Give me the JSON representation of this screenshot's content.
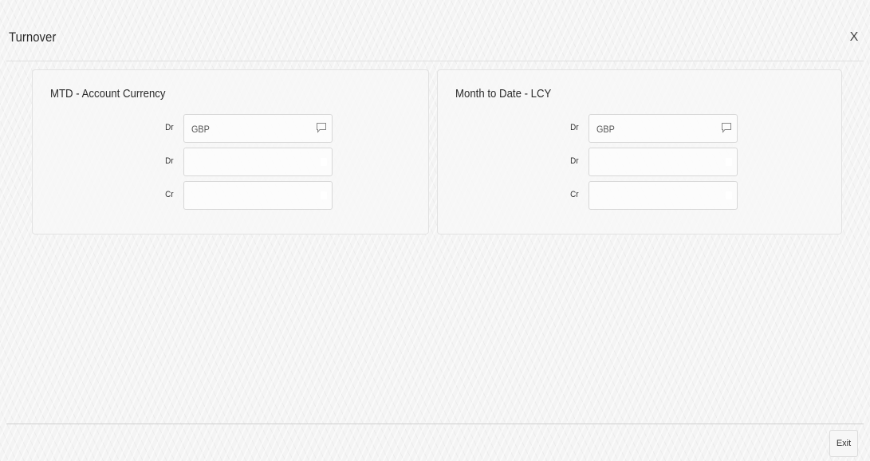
{
  "window": {
    "title": "Turnover",
    "close_label": "X"
  },
  "panels": [
    {
      "heading": "MTD - Account Currency",
      "rows": [
        {
          "label": "Dr",
          "value": "GBP",
          "icon": "note-icon"
        },
        {
          "label": "Dr",
          "value": "",
          "icon": null
        },
        {
          "label": "Cr",
          "value": "",
          "icon": null
        }
      ]
    },
    {
      "heading": "Month to Date - LCY",
      "rows": [
        {
          "label": "Dr",
          "value": "GBP",
          "icon": "note-icon"
        },
        {
          "label": "Dr",
          "value": "",
          "icon": null
        },
        {
          "label": "Cr",
          "value": "",
          "icon": null
        }
      ]
    }
  ],
  "footer": {
    "exit_label": "Exit"
  }
}
